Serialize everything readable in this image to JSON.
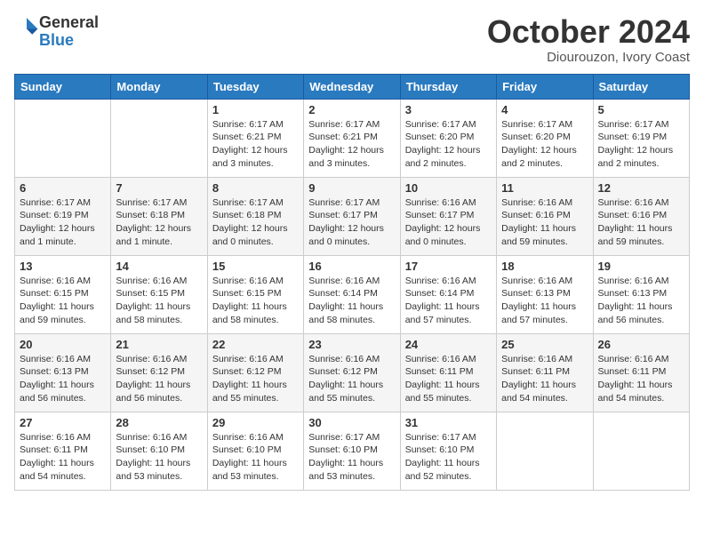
{
  "header": {
    "logo_general": "General",
    "logo_blue": "Blue",
    "month_title": "October 2024",
    "location": "Diourouzon, Ivory Coast"
  },
  "days_of_week": [
    "Sunday",
    "Monday",
    "Tuesday",
    "Wednesday",
    "Thursday",
    "Friday",
    "Saturday"
  ],
  "weeks": [
    [
      {
        "day": "",
        "sunrise": "",
        "sunset": "",
        "daylight": ""
      },
      {
        "day": "",
        "sunrise": "",
        "sunset": "",
        "daylight": ""
      },
      {
        "day": "1",
        "sunrise": "Sunrise: 6:17 AM",
        "sunset": "Sunset: 6:21 PM",
        "daylight": "Daylight: 12 hours and 3 minutes."
      },
      {
        "day": "2",
        "sunrise": "Sunrise: 6:17 AM",
        "sunset": "Sunset: 6:21 PM",
        "daylight": "Daylight: 12 hours and 3 minutes."
      },
      {
        "day": "3",
        "sunrise": "Sunrise: 6:17 AM",
        "sunset": "Sunset: 6:20 PM",
        "daylight": "Daylight: 12 hours and 2 minutes."
      },
      {
        "day": "4",
        "sunrise": "Sunrise: 6:17 AM",
        "sunset": "Sunset: 6:20 PM",
        "daylight": "Daylight: 12 hours and 2 minutes."
      },
      {
        "day": "5",
        "sunrise": "Sunrise: 6:17 AM",
        "sunset": "Sunset: 6:19 PM",
        "daylight": "Daylight: 12 hours and 2 minutes."
      }
    ],
    [
      {
        "day": "6",
        "sunrise": "Sunrise: 6:17 AM",
        "sunset": "Sunset: 6:19 PM",
        "daylight": "Daylight: 12 hours and 1 minute."
      },
      {
        "day": "7",
        "sunrise": "Sunrise: 6:17 AM",
        "sunset": "Sunset: 6:18 PM",
        "daylight": "Daylight: 12 hours and 1 minute."
      },
      {
        "day": "8",
        "sunrise": "Sunrise: 6:17 AM",
        "sunset": "Sunset: 6:18 PM",
        "daylight": "Daylight: 12 hours and 0 minutes."
      },
      {
        "day": "9",
        "sunrise": "Sunrise: 6:17 AM",
        "sunset": "Sunset: 6:17 PM",
        "daylight": "Daylight: 12 hours and 0 minutes."
      },
      {
        "day": "10",
        "sunrise": "Sunrise: 6:16 AM",
        "sunset": "Sunset: 6:17 PM",
        "daylight": "Daylight: 12 hours and 0 minutes."
      },
      {
        "day": "11",
        "sunrise": "Sunrise: 6:16 AM",
        "sunset": "Sunset: 6:16 PM",
        "daylight": "Daylight: 11 hours and 59 minutes."
      },
      {
        "day": "12",
        "sunrise": "Sunrise: 6:16 AM",
        "sunset": "Sunset: 6:16 PM",
        "daylight": "Daylight: 11 hours and 59 minutes."
      }
    ],
    [
      {
        "day": "13",
        "sunrise": "Sunrise: 6:16 AM",
        "sunset": "Sunset: 6:15 PM",
        "daylight": "Daylight: 11 hours and 59 minutes."
      },
      {
        "day": "14",
        "sunrise": "Sunrise: 6:16 AM",
        "sunset": "Sunset: 6:15 PM",
        "daylight": "Daylight: 11 hours and 58 minutes."
      },
      {
        "day": "15",
        "sunrise": "Sunrise: 6:16 AM",
        "sunset": "Sunset: 6:15 PM",
        "daylight": "Daylight: 11 hours and 58 minutes."
      },
      {
        "day": "16",
        "sunrise": "Sunrise: 6:16 AM",
        "sunset": "Sunset: 6:14 PM",
        "daylight": "Daylight: 11 hours and 58 minutes."
      },
      {
        "day": "17",
        "sunrise": "Sunrise: 6:16 AM",
        "sunset": "Sunset: 6:14 PM",
        "daylight": "Daylight: 11 hours and 57 minutes."
      },
      {
        "day": "18",
        "sunrise": "Sunrise: 6:16 AM",
        "sunset": "Sunset: 6:13 PM",
        "daylight": "Daylight: 11 hours and 57 minutes."
      },
      {
        "day": "19",
        "sunrise": "Sunrise: 6:16 AM",
        "sunset": "Sunset: 6:13 PM",
        "daylight": "Daylight: 11 hours and 56 minutes."
      }
    ],
    [
      {
        "day": "20",
        "sunrise": "Sunrise: 6:16 AM",
        "sunset": "Sunset: 6:13 PM",
        "daylight": "Daylight: 11 hours and 56 minutes."
      },
      {
        "day": "21",
        "sunrise": "Sunrise: 6:16 AM",
        "sunset": "Sunset: 6:12 PM",
        "daylight": "Daylight: 11 hours and 56 minutes."
      },
      {
        "day": "22",
        "sunrise": "Sunrise: 6:16 AM",
        "sunset": "Sunset: 6:12 PM",
        "daylight": "Daylight: 11 hours and 55 minutes."
      },
      {
        "day": "23",
        "sunrise": "Sunrise: 6:16 AM",
        "sunset": "Sunset: 6:12 PM",
        "daylight": "Daylight: 11 hours and 55 minutes."
      },
      {
        "day": "24",
        "sunrise": "Sunrise: 6:16 AM",
        "sunset": "Sunset: 6:11 PM",
        "daylight": "Daylight: 11 hours and 55 minutes."
      },
      {
        "day": "25",
        "sunrise": "Sunrise: 6:16 AM",
        "sunset": "Sunset: 6:11 PM",
        "daylight": "Daylight: 11 hours and 54 minutes."
      },
      {
        "day": "26",
        "sunrise": "Sunrise: 6:16 AM",
        "sunset": "Sunset: 6:11 PM",
        "daylight": "Daylight: 11 hours and 54 minutes."
      }
    ],
    [
      {
        "day": "27",
        "sunrise": "Sunrise: 6:16 AM",
        "sunset": "Sunset: 6:11 PM",
        "daylight": "Daylight: 11 hours and 54 minutes."
      },
      {
        "day": "28",
        "sunrise": "Sunrise: 6:16 AM",
        "sunset": "Sunset: 6:10 PM",
        "daylight": "Daylight: 11 hours and 53 minutes."
      },
      {
        "day": "29",
        "sunrise": "Sunrise: 6:16 AM",
        "sunset": "Sunset: 6:10 PM",
        "daylight": "Daylight: 11 hours and 53 minutes."
      },
      {
        "day": "30",
        "sunrise": "Sunrise: 6:17 AM",
        "sunset": "Sunset: 6:10 PM",
        "daylight": "Daylight: 11 hours and 53 minutes."
      },
      {
        "day": "31",
        "sunrise": "Sunrise: 6:17 AM",
        "sunset": "Sunset: 6:10 PM",
        "daylight": "Daylight: 11 hours and 52 minutes."
      },
      {
        "day": "",
        "sunrise": "",
        "sunset": "",
        "daylight": ""
      },
      {
        "day": "",
        "sunrise": "",
        "sunset": "",
        "daylight": ""
      }
    ]
  ]
}
